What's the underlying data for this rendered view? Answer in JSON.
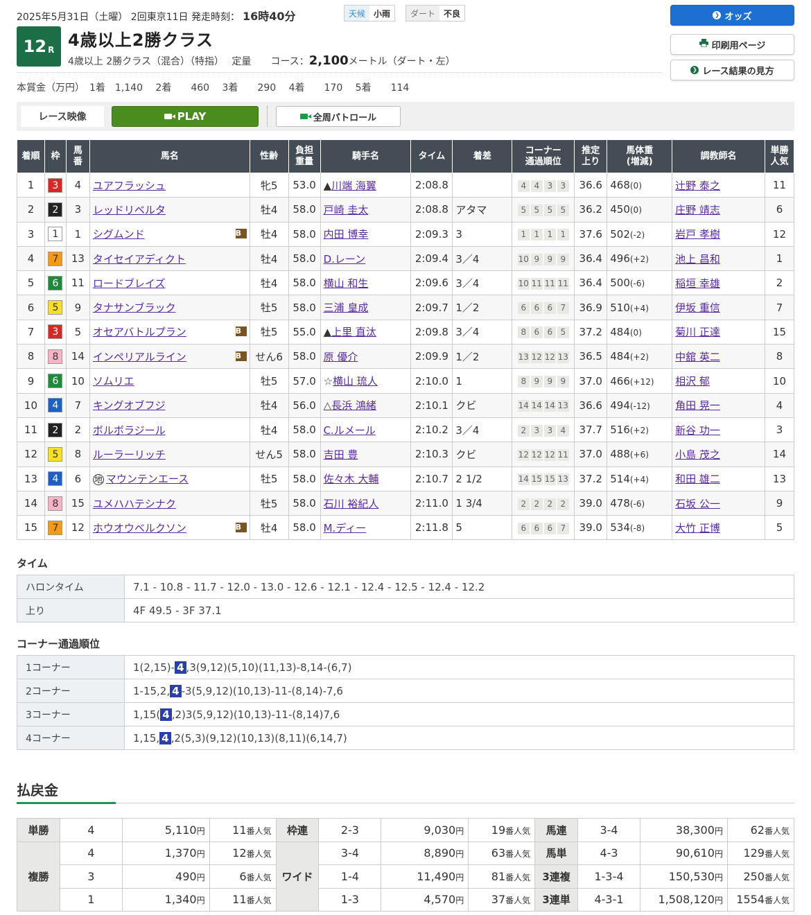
{
  "header": {
    "date_line": "2025年5月31日（土曜） 2回東京11日 発走時刻：",
    "post_time": "16時40分",
    "weather_label": "天候",
    "weather_value": "小雨",
    "track_label": "ダート",
    "track_value": "不良",
    "race_num": "12",
    "race_suffix": "R",
    "race_title": "4歳以上2勝クラス",
    "race_conditions": "4歳以上 2勝クラス（混合）（特指）　 定量　　コース：",
    "course_distance": "2,100",
    "course_unit": "メートル（ダート・左）",
    "prize_line": "本賞金（万円）　1着　1,140　 2着　　460　 3着　　290　 4着　　170　 5着　　114"
  },
  "buttons": {
    "odds": "オッズ",
    "print": "印刷用ページ",
    "howto": "レース結果の見方"
  },
  "video": {
    "label": "レース映像",
    "play": "PLAY",
    "patrol": "全周パトロール"
  },
  "columns": [
    "着順",
    "枠",
    "馬番",
    "馬名",
    "性齢",
    "負担重量",
    "騎手名",
    "タイム",
    "着差",
    "コーナー通過順位",
    "推定上り",
    "馬体重(増減)",
    "調教師名",
    "単勝人気"
  ],
  "column_lines": {
    "umaban": [
      "馬",
      "番"
    ],
    "futan": [
      "負担",
      "重量"
    ],
    "corner": [
      "コーナー",
      "通過順位"
    ],
    "agari": [
      "推定",
      "上り"
    ],
    "weight": [
      "馬体重",
      "(増減)"
    ],
    "ninki": [
      "単勝",
      "人気"
    ]
  },
  "results": [
    {
      "rank": "1",
      "waku": "3",
      "num": "4",
      "name": "ユアフラッシュ",
      "blinker": false,
      "local": false,
      "sex": "牝5",
      "wt": "53.0",
      "jmark": "▲",
      "jockey": "川端 海翼",
      "time": "2:08.8",
      "margin": "",
      "corners": [
        "4",
        "4",
        "3",
        "3"
      ],
      "agari": "36.6",
      "bw": "468",
      "bwd": "(0)",
      "trainer": "辻野 泰之",
      "pop": "11"
    },
    {
      "rank": "2",
      "waku": "2",
      "num": "3",
      "name": "レッドリベルタ",
      "blinker": false,
      "local": false,
      "sex": "牡4",
      "wt": "58.0",
      "jmark": "",
      "jockey": "戸崎 圭太",
      "time": "2:08.8",
      "margin": "アタマ",
      "corners": [
        "5",
        "5",
        "5",
        "5"
      ],
      "agari": "36.2",
      "bw": "450",
      "bwd": "(0)",
      "trainer": "庄野 靖志",
      "pop": "6"
    },
    {
      "rank": "3",
      "waku": "1",
      "num": "1",
      "name": "シグムンド",
      "blinker": true,
      "local": false,
      "sex": "牡4",
      "wt": "58.0",
      "jmark": "",
      "jockey": "内田 博幸",
      "time": "2:09.3",
      "margin": "3",
      "corners": [
        "1",
        "1",
        "1",
        "1"
      ],
      "agari": "37.6",
      "bw": "502",
      "bwd": "(-2)",
      "trainer": "岩戸 孝樹",
      "pop": "12"
    },
    {
      "rank": "4",
      "waku": "7",
      "num": "13",
      "name": "タイセイアディクト",
      "blinker": false,
      "local": false,
      "sex": "牡4",
      "wt": "58.0",
      "jmark": "",
      "jockey": "D.レーン",
      "time": "2:09.4",
      "margin": "3／4",
      "corners": [
        "10",
        "9",
        "9",
        "9"
      ],
      "agari": "36.4",
      "bw": "496",
      "bwd": "(+2)",
      "trainer": "池上 昌和",
      "pop": "1"
    },
    {
      "rank": "5",
      "waku": "6",
      "num": "11",
      "name": "ロードブレイズ",
      "blinker": false,
      "local": false,
      "sex": "牡4",
      "wt": "58.0",
      "jmark": "",
      "jockey": "横山 和生",
      "time": "2:09.6",
      "margin": "3／4",
      "corners": [
        "10",
        "11",
        "11",
        "11"
      ],
      "agari": "36.4",
      "bw": "500",
      "bwd": "(-6)",
      "trainer": "稲垣 幸雄",
      "pop": "2"
    },
    {
      "rank": "6",
      "waku": "5",
      "num": "9",
      "name": "タナサンブラック",
      "blinker": false,
      "local": false,
      "sex": "牡5",
      "wt": "58.0",
      "jmark": "",
      "jockey": "三浦 皇成",
      "time": "2:09.7",
      "margin": "1／2",
      "corners": [
        "6",
        "6",
        "6",
        "7"
      ],
      "agari": "36.9",
      "bw": "510",
      "bwd": "(+4)",
      "trainer": "伊坂 重信",
      "pop": "7"
    },
    {
      "rank": "7",
      "waku": "3",
      "num": "5",
      "name": "オセアバトルプラン",
      "blinker": true,
      "local": false,
      "sex": "牡5",
      "wt": "55.0",
      "jmark": "▲",
      "jockey": "上里 直汰",
      "time": "2:09.8",
      "margin": "3／4",
      "corners": [
        "8",
        "6",
        "6",
        "5"
      ],
      "agari": "37.2",
      "bw": "484",
      "bwd": "(0)",
      "trainer": "菊川 正達",
      "pop": "15"
    },
    {
      "rank": "8",
      "waku": "8",
      "num": "14",
      "name": "インペリアルライン",
      "blinker": true,
      "local": false,
      "sex": "せん6",
      "wt": "58.0",
      "jmark": "",
      "jockey": "原 優介",
      "time": "2:09.9",
      "margin": "1／2",
      "corners": [
        "13",
        "12",
        "12",
        "13"
      ],
      "agari": "36.5",
      "bw": "484",
      "bwd": "(+2)",
      "trainer": "中舘 英二",
      "pop": "8"
    },
    {
      "rank": "9",
      "waku": "6",
      "num": "10",
      "name": "ソムリエ",
      "blinker": false,
      "local": false,
      "sex": "牡5",
      "wt": "57.0",
      "jmark": "☆",
      "jockey": "横山 琉人",
      "time": "2:10.0",
      "margin": "1",
      "corners": [
        "8",
        "9",
        "9",
        "9"
      ],
      "agari": "37.0",
      "bw": "466",
      "bwd": "(+12)",
      "trainer": "相沢 郁",
      "pop": "10"
    },
    {
      "rank": "10",
      "waku": "4",
      "num": "7",
      "name": "キングオブフジ",
      "blinker": false,
      "local": false,
      "sex": "牡4",
      "wt": "56.0",
      "jmark": "△",
      "jockey": "長浜 鴻緒",
      "time": "2:10.1",
      "margin": "クビ",
      "corners": [
        "14",
        "14",
        "14",
        "13"
      ],
      "agari": "36.6",
      "bw": "494",
      "bwd": "(-12)",
      "trainer": "角田 晃一",
      "pop": "4"
    },
    {
      "rank": "11",
      "waku": "2",
      "num": "2",
      "name": "ボルボラジール",
      "blinker": false,
      "local": false,
      "sex": "牡4",
      "wt": "58.0",
      "jmark": "",
      "jockey": "C.ルメール",
      "time": "2:10.2",
      "margin": "3／4",
      "corners": [
        "2",
        "3",
        "3",
        "4"
      ],
      "agari": "37.7",
      "bw": "516",
      "bwd": "(+2)",
      "trainer": "新谷 功一",
      "pop": "3"
    },
    {
      "rank": "12",
      "waku": "5",
      "num": "8",
      "name": "ルーラーリッチ",
      "blinker": false,
      "local": false,
      "sex": "せん5",
      "wt": "58.0",
      "jmark": "",
      "jockey": "吉田 豊",
      "time": "2:10.3",
      "margin": "クビ",
      "corners": [
        "12",
        "12",
        "12",
        "11"
      ],
      "agari": "37.0",
      "bw": "488",
      "bwd": "(+6)",
      "trainer": "小島 茂之",
      "pop": "14"
    },
    {
      "rank": "13",
      "waku": "4",
      "num": "6",
      "name": "マウンテンエース",
      "blinker": false,
      "local": true,
      "sex": "牡5",
      "wt": "58.0",
      "jmark": "",
      "jockey": "佐々木 大輔",
      "time": "2:10.7",
      "margin": "2 1/2",
      "corners": [
        "14",
        "15",
        "15",
        "13"
      ],
      "agari": "37.2",
      "bw": "514",
      "bwd": "(+4)",
      "trainer": "和田 雄二",
      "pop": "13"
    },
    {
      "rank": "14",
      "waku": "8",
      "num": "15",
      "name": "ユメハハテシナク",
      "blinker": false,
      "local": false,
      "sex": "牡5",
      "wt": "58.0",
      "jmark": "",
      "jockey": "石川 裕紀人",
      "time": "2:11.0",
      "margin": "1 3/4",
      "corners": [
        "2",
        "2",
        "2",
        "2"
      ],
      "agari": "39.0",
      "bw": "478",
      "bwd": "(-6)",
      "trainer": "石坂 公一",
      "pop": "9"
    },
    {
      "rank": "15",
      "waku": "7",
      "num": "12",
      "name": "ホウオウベルクソン",
      "blinker": true,
      "local": false,
      "sex": "牡4",
      "wt": "58.0",
      "jmark": "",
      "jockey": "M.ディー",
      "time": "2:11.8",
      "margin": "5",
      "corners": [
        "6",
        "6",
        "6",
        "7"
      ],
      "agari": "39.0",
      "bw": "534",
      "bwd": "(-8)",
      "trainer": "大竹 正博",
      "pop": "5"
    }
  ],
  "blinker_mark": "B",
  "local_mark": "地",
  "waku_colors": {
    "1": {
      "bg": "#ffffff",
      "fg": "#333333"
    },
    "2": {
      "bg": "#222222",
      "fg": "#ffffff"
    },
    "3": {
      "bg": "#d62828",
      "fg": "#ffffff"
    },
    "4": {
      "bg": "#1f5fc4",
      "fg": "#ffffff"
    },
    "5": {
      "bg": "#f5df2a",
      "fg": "#333333"
    },
    "6": {
      "bg": "#1f8a3c",
      "fg": "#ffffff"
    },
    "7": {
      "bg": "#f39a1a",
      "fg": "#333333"
    },
    "8": {
      "bg": "#f7b3c8",
      "fg": "#333333"
    }
  },
  "time_section": {
    "heading": "タイム",
    "rows": [
      {
        "label": "ハロンタイム",
        "value": "7.1 - 10.8 - 11.7 - 12.0 - 13.0 - 12.6 - 12.1 - 12.4 - 12.5 - 12.4 - 12.2"
      },
      {
        "label": "上り",
        "value": "4F 49.5 - 3F 37.1"
      }
    ]
  },
  "corner_section": {
    "heading": "コーナー通過順位",
    "rows": [
      {
        "label": "1コーナー",
        "pre": "1(2,15)-",
        "hl": "4",
        "post": ",3(9,12)(5,10)(11,13)-8,14-(6,7)"
      },
      {
        "label": "2コーナー",
        "pre": "1-15,2,",
        "hl": "4",
        "post": "-3(5,9,12)(10,13)-11-(8,14)-7,6"
      },
      {
        "label": "3コーナー",
        "pre": "1,15(",
        "hl": "4",
        "post": ",2)3(5,9,12)(10,13)-11-(8,14)7,6"
      },
      {
        "label": "4コーナー",
        "pre": "1,15,",
        "hl": "4",
        "post": ",2(5,3)(9,12)(10,13)(8,11)(6,14,7)"
      }
    ]
  },
  "payout": {
    "heading": "払戻金",
    "yen": "円",
    "ninki": "番人気",
    "tansho": {
      "label": "単勝",
      "rows": [
        {
          "combo": "4",
          "amount": "5,110",
          "pop": "11"
        }
      ]
    },
    "fukusho": {
      "label": "複勝",
      "rows": [
        {
          "combo": "4",
          "amount": "1,370",
          "pop": "12"
        },
        {
          "combo": "3",
          "amount": "490",
          "pop": "6"
        },
        {
          "combo": "1",
          "amount": "1,340",
          "pop": "11"
        }
      ]
    },
    "wakuren": {
      "label": "枠連",
      "rows": [
        {
          "combo": "2-3",
          "amount": "9,030",
          "pop": "19"
        }
      ]
    },
    "wide": {
      "label": "ワイド",
      "rows": [
        {
          "combo": "3-4",
          "amount": "8,890",
          "pop": "63"
        },
        {
          "combo": "1-4",
          "amount": "11,490",
          "pop": "81"
        },
        {
          "combo": "1-3",
          "amount": "4,570",
          "pop": "37"
        }
      ]
    },
    "umaren": {
      "label": "馬連",
      "rows": [
        {
          "combo": "3-4",
          "amount": "38,300",
          "pop": "62"
        }
      ]
    },
    "umatan": {
      "label": "馬単",
      "rows": [
        {
          "combo": "4-3",
          "amount": "90,610",
          "pop": "129"
        }
      ]
    },
    "sanrenpuku": {
      "label": "3連複",
      "rows": [
        {
          "combo": "1-3-4",
          "amount": "150,530",
          "pop": "250"
        }
      ]
    },
    "sanrentan": {
      "label": "3連単",
      "rows": [
        {
          "combo": "4-3-1",
          "amount": "1,508,120",
          "pop": "1554"
        }
      ]
    }
  }
}
